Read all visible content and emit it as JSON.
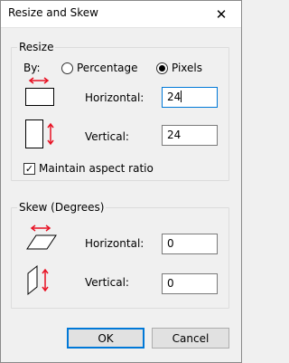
{
  "window": {
    "title": "Resize and Skew",
    "close_icon": "close-icon"
  },
  "resize": {
    "group_label": "Resize",
    "by_label": "By:",
    "options": [
      {
        "label": "Percentage",
        "selected": false
      },
      {
        "label": "Pixels",
        "selected": true
      }
    ],
    "horizontal_label": "Horizontal:",
    "horizontal_value": "24",
    "vertical_label": "Vertical:",
    "vertical_value": "24",
    "maintain_aspect_label": "Maintain aspect ratio",
    "maintain_aspect_checked": true
  },
  "skew": {
    "group_label": "Skew (Degrees)",
    "horizontal_label": "Horizontal:",
    "horizontal_value": "0",
    "vertical_label": "Vertical:",
    "vertical_value": "0"
  },
  "buttons": {
    "ok_label": "OK",
    "cancel_label": "Cancel"
  },
  "colors": {
    "arrow_red": "#e81123",
    "focus_blue": "#0078d7"
  }
}
